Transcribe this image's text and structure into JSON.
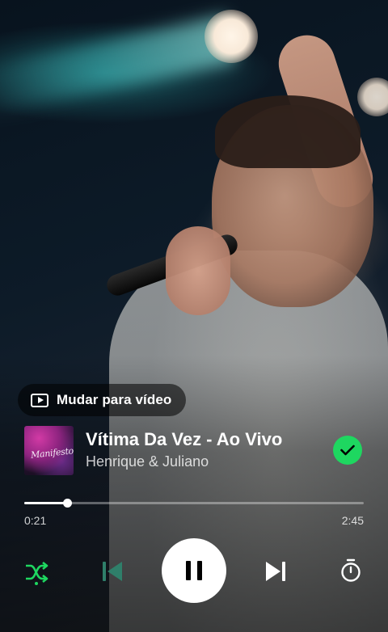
{
  "video_switch": {
    "label": "Mudar para vídeo",
    "icon": "play-video-icon"
  },
  "track": {
    "title": "Vítima Da Vez - Ao Vivo",
    "artist": "Henrique & Juliano",
    "saved": true,
    "album_art_text": "Manifesto",
    "icon": "saved-check-icon"
  },
  "progress": {
    "elapsed": "0:21",
    "total": "2:45",
    "fraction": 0.127
  },
  "controls": {
    "shuffle": {
      "icon": "shuffle-icon",
      "active": true
    },
    "previous": {
      "icon": "skip-previous-icon",
      "enabled": false
    },
    "play_pause": {
      "icon": "pause-icon",
      "state": "playing"
    },
    "next": {
      "icon": "skip-next-icon"
    },
    "sleep_timer": {
      "icon": "timer-icon"
    }
  },
  "colors": {
    "accent": "#1ed760",
    "text": "#ffffff",
    "disabled": "#2f7f6a"
  }
}
